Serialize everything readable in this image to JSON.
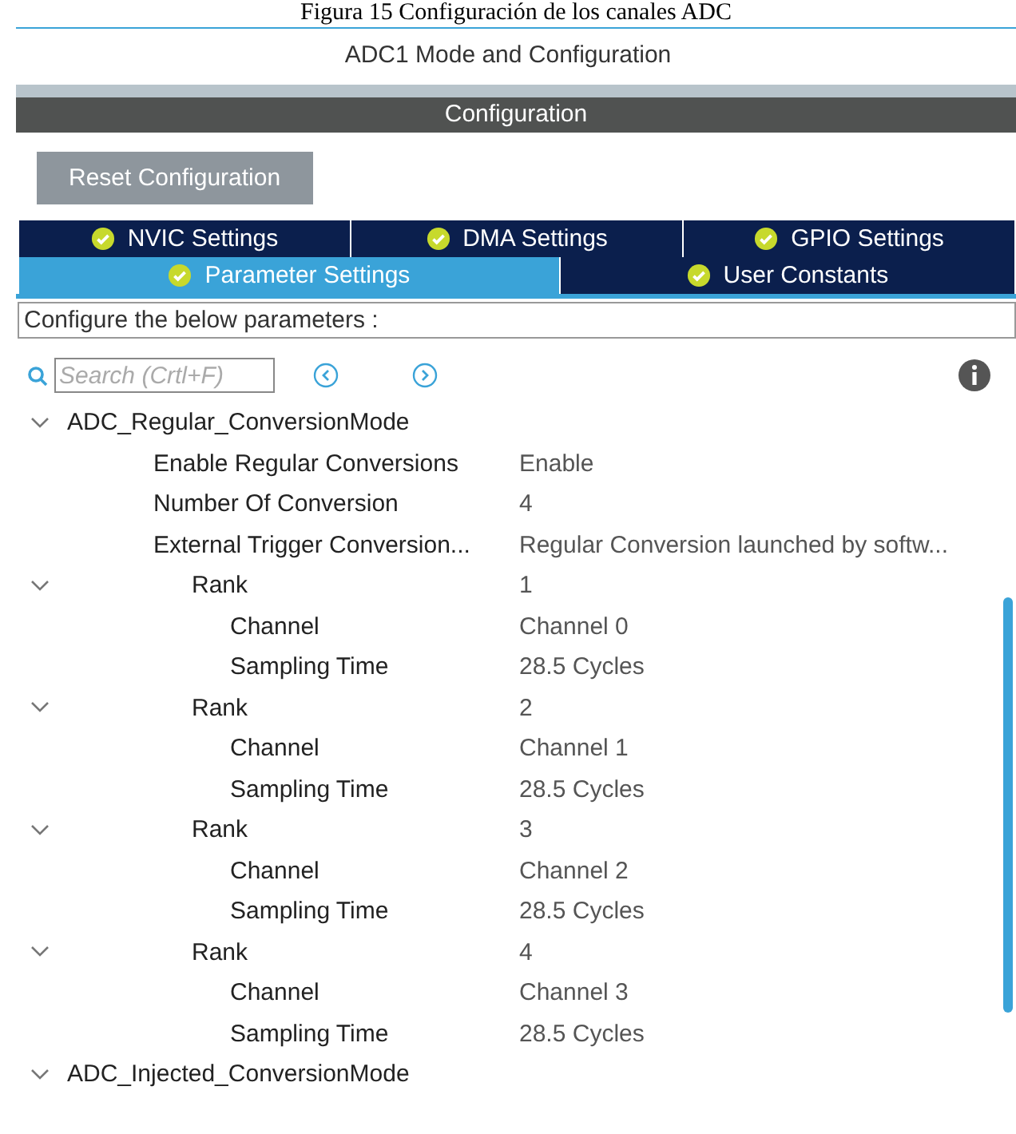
{
  "caption": "Figura 15 Configuración de los canales ADC",
  "panel_title": "ADC1 Mode and Configuration",
  "section_title": "Configuration",
  "reset_button": "Reset Configuration",
  "tab_rows": [
    [
      {
        "label": "NVIC Settings",
        "selected": false
      },
      {
        "label": "DMA Settings",
        "selected": false
      },
      {
        "label": "GPIO Settings",
        "selected": false
      }
    ],
    [
      {
        "label": "Parameter Settings",
        "selected": true
      },
      {
        "label": "User Constants",
        "selected": false
      }
    ]
  ],
  "instructions": "Configure the below parameters :",
  "search": {
    "placeholder": "Search (Crtl+F)"
  },
  "tree": [
    {
      "label": "ADC_Regular_ConversionMode",
      "expanded": true,
      "children": [
        {
          "label": "Enable Regular Conversions",
          "value": "Enable"
        },
        {
          "label": "Number Of Conversion",
          "value": "4"
        },
        {
          "label": "External Trigger Conversion...",
          "value": "Regular Conversion launched by softw..."
        },
        {
          "label": "Rank",
          "value": "1",
          "expanded": true,
          "children": [
            {
              "label": "Channel",
              "value": "Channel 0"
            },
            {
              "label": "Sampling Time",
              "value": "28.5 Cycles"
            }
          ]
        },
        {
          "label": "Rank",
          "value": "2",
          "expanded": true,
          "children": [
            {
              "label": "Channel",
              "value": "Channel 1"
            },
            {
              "label": "Sampling Time",
              "value": "28.5 Cycles"
            }
          ]
        },
        {
          "label": "Rank",
          "value": "3",
          "expanded": true,
          "children": [
            {
              "label": "Channel",
              "value": "Channel 2"
            },
            {
              "label": "Sampling Time",
              "value": "28.5 Cycles"
            }
          ]
        },
        {
          "label": "Rank",
          "value": "4",
          "expanded": true,
          "children": [
            {
              "label": "Channel",
              "value": "Channel 3"
            },
            {
              "label": "Sampling Time",
              "value": "28.5 Cycles"
            }
          ]
        }
      ]
    },
    {
      "label": "ADC_Injected_ConversionMode",
      "expanded": true
    }
  ]
}
